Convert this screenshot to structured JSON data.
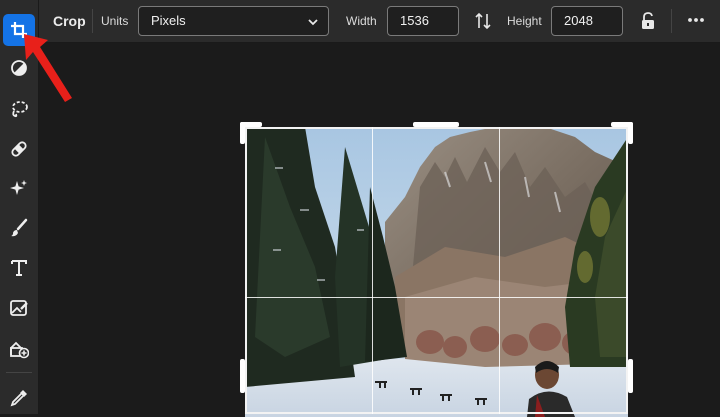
{
  "tools": [
    {
      "name": "crop-icon",
      "active": true
    },
    {
      "name": "adjustment-icon",
      "active": false
    },
    {
      "name": "lasso-select-icon",
      "active": false
    },
    {
      "name": "healing-bandage-icon",
      "active": false
    },
    {
      "name": "sparkle-effects-icon",
      "active": false
    },
    {
      "name": "brush-icon",
      "active": false
    },
    {
      "name": "type-icon",
      "active": false
    },
    {
      "name": "image-edit-icon",
      "active": false
    },
    {
      "name": "add-image-icon",
      "active": false
    },
    {
      "name": "eyedropper-icon",
      "active": false
    }
  ],
  "options": {
    "title": "Crop",
    "units_label": "Units",
    "units_value": "Pixels",
    "width_label": "Width",
    "width_value": "1536",
    "height_label": "Height",
    "height_value": "2048"
  },
  "colors": {
    "accent": "#1473e6",
    "annotation_arrow": "#e8201a",
    "toolbar_bg": "#2b2b2b",
    "canvas_bg": "#1b1b1b"
  }
}
